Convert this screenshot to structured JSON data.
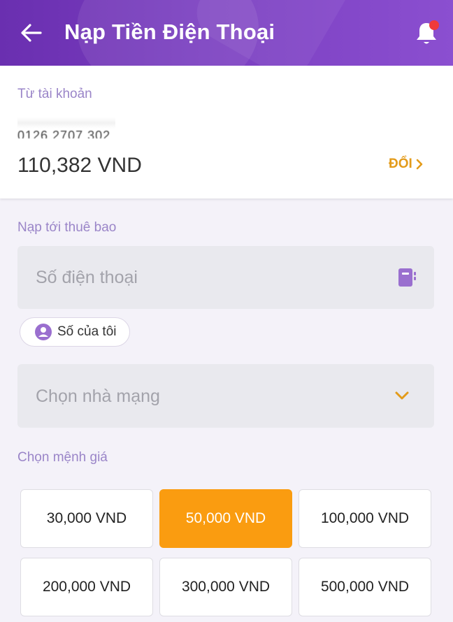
{
  "header": {
    "title": "Nạp Tiền Điện Thoại",
    "back_icon": "arrow-left-icon",
    "bell_icon": "bell-icon",
    "has_notification": true,
    "colors": {
      "bg": "#7433b8",
      "notification": "#f03a3a"
    }
  },
  "account": {
    "label": "Từ tài khoản",
    "number_partial": "0126 2707 302",
    "balance": "110,382 VND",
    "change_label": "ĐỔI",
    "change_icon": "chevron-right-icon"
  },
  "recipient": {
    "label": "Nạp tới thuê bao",
    "phone_placeholder": "Số điện thoại",
    "contact_icon": "contact-book-icon",
    "my_number_label": "Số của tôi",
    "my_number_icon": "user-circle-icon"
  },
  "network": {
    "placeholder": "Chọn nhà mạng",
    "chevron_icon": "chevron-down-icon"
  },
  "amounts": {
    "label": "Chọn mệnh giá",
    "options": [
      "30,000 VND",
      "50,000 VND",
      "100,000 VND",
      "200,000 VND",
      "300,000 VND",
      "500,000 VND"
    ],
    "selected": "50,000 VND",
    "colors": {
      "selected_bg": "#fa9c10",
      "accent": "#e39b1a",
      "label": "#9a85c8"
    }
  }
}
